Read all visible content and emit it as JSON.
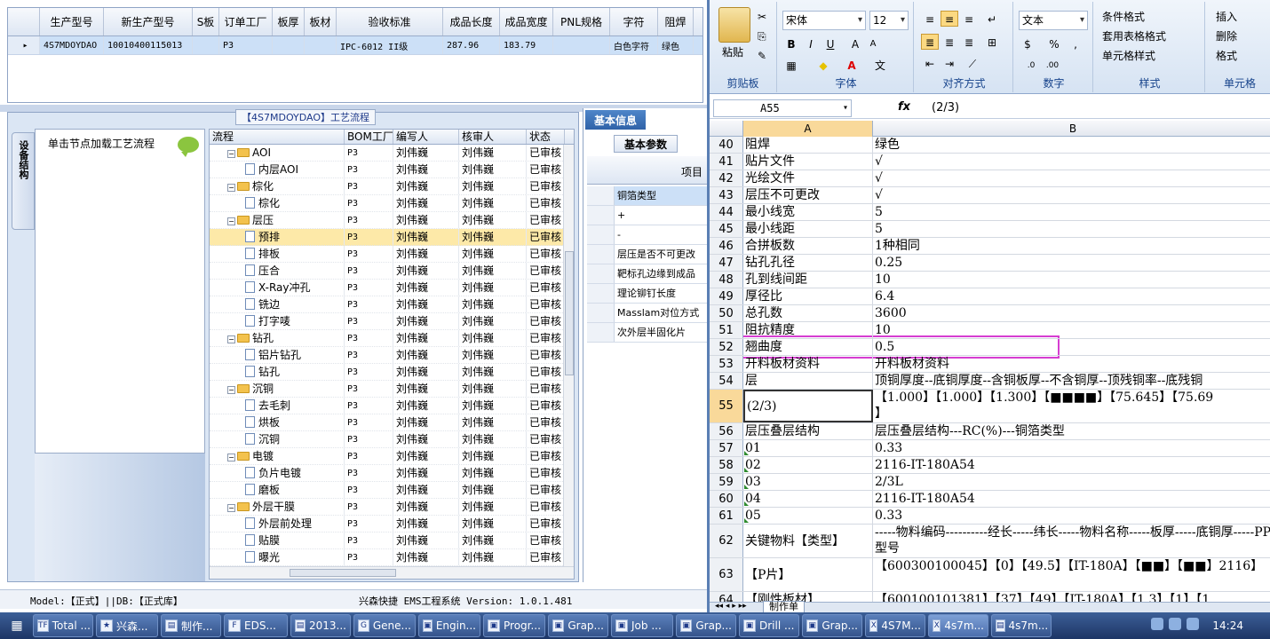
{
  "top_grid": {
    "columns": [
      "",
      "生产型号",
      "新生产型号",
      "S板",
      "订单工厂",
      "板厚",
      "板材",
      "验收标准",
      "成品长度",
      "成品宽度",
      "PNL规格",
      "字符",
      "阻焊"
    ],
    "row": [
      "▸",
      "4S7MDOYDAO",
      "10010400115013",
      "",
      "P3",
      "",
      "",
      "IPC-6012 II级",
      "287.96",
      "183.79",
      "",
      "白色字符",
      "绿色"
    ]
  },
  "process": {
    "title": "【4S7MDOYDAO】工艺流程",
    "side_tab": "设备结构",
    "hint": "单击节点加载工艺流程",
    "headers": [
      "流程",
      "BOM工厂",
      "编写人",
      "核审人",
      "状态"
    ],
    "rows": [
      {
        "level": 0,
        "type": "folder",
        "name": "AOI",
        "bom": "P3",
        "writer": "刘伟巍",
        "reviewer": "刘伟巍",
        "status": "已审核"
      },
      {
        "level": 1,
        "type": "doc",
        "name": "内层AOI",
        "bom": "P3",
        "writer": "刘伟巍",
        "reviewer": "刘伟巍",
        "status": "已审核"
      },
      {
        "level": 0,
        "type": "folder",
        "name": "棕化",
        "bom": "P3",
        "writer": "刘伟巍",
        "reviewer": "刘伟巍",
        "status": "已审核"
      },
      {
        "level": 1,
        "type": "doc",
        "name": "棕化",
        "bom": "P3",
        "writer": "刘伟巍",
        "reviewer": "刘伟巍",
        "status": "已审核"
      },
      {
        "level": 0,
        "type": "folder",
        "name": "层压",
        "bom": "P3",
        "writer": "刘伟巍",
        "reviewer": "刘伟巍",
        "status": "已审核"
      },
      {
        "level": 1,
        "type": "doc",
        "name": "预排",
        "bom": "P3",
        "writer": "刘伟巍",
        "reviewer": "刘伟巍",
        "status": "已审核",
        "highlight": true
      },
      {
        "level": 1,
        "type": "doc",
        "name": "排板",
        "bom": "P3",
        "writer": "刘伟巍",
        "reviewer": "刘伟巍",
        "status": "已审核"
      },
      {
        "level": 1,
        "type": "doc",
        "name": "压合",
        "bom": "P3",
        "writer": "刘伟巍",
        "reviewer": "刘伟巍",
        "status": "已审核"
      },
      {
        "level": 1,
        "type": "doc",
        "name": "X-Ray冲孔",
        "bom": "P3",
        "writer": "刘伟巍",
        "reviewer": "刘伟巍",
        "status": "已审核"
      },
      {
        "level": 1,
        "type": "doc",
        "name": "铣边",
        "bom": "P3",
        "writer": "刘伟巍",
        "reviewer": "刘伟巍",
        "status": "已审核"
      },
      {
        "level": 1,
        "type": "doc",
        "name": "打字唛",
        "bom": "P3",
        "writer": "刘伟巍",
        "reviewer": "刘伟巍",
        "status": "已审核"
      },
      {
        "level": 0,
        "type": "folder",
        "name": "钻孔",
        "bom": "P3",
        "writer": "刘伟巍",
        "reviewer": "刘伟巍",
        "status": "已审核"
      },
      {
        "level": 1,
        "type": "doc",
        "name": "铝片钻孔",
        "bom": "P3",
        "writer": "刘伟巍",
        "reviewer": "刘伟巍",
        "status": "已审核"
      },
      {
        "level": 1,
        "type": "doc",
        "name": "钻孔",
        "bom": "P3",
        "writer": "刘伟巍",
        "reviewer": "刘伟巍",
        "status": "已审核"
      },
      {
        "level": 0,
        "type": "folder",
        "name": "沉铜",
        "bom": "P3",
        "writer": "刘伟巍",
        "reviewer": "刘伟巍",
        "status": "已审核"
      },
      {
        "level": 1,
        "type": "doc",
        "name": "去毛刺",
        "bom": "P3",
        "writer": "刘伟巍",
        "reviewer": "刘伟巍",
        "status": "已审核"
      },
      {
        "level": 1,
        "type": "doc",
        "name": "烘板",
        "bom": "P3",
        "writer": "刘伟巍",
        "reviewer": "刘伟巍",
        "status": "已审核"
      },
      {
        "level": 1,
        "type": "doc",
        "name": "沉铜",
        "bom": "P3",
        "writer": "刘伟巍",
        "reviewer": "刘伟巍",
        "status": "已审核"
      },
      {
        "level": 0,
        "type": "folder",
        "name": "电镀",
        "bom": "P3",
        "writer": "刘伟巍",
        "reviewer": "刘伟巍",
        "status": "已审核"
      },
      {
        "level": 1,
        "type": "doc",
        "name": "负片电镀",
        "bom": "P3",
        "writer": "刘伟巍",
        "reviewer": "刘伟巍",
        "status": "已审核"
      },
      {
        "level": 1,
        "type": "doc",
        "name": "磨板",
        "bom": "P3",
        "writer": "刘伟巍",
        "reviewer": "刘伟巍",
        "status": "已审核"
      },
      {
        "level": 0,
        "type": "folder",
        "name": "外层干膜",
        "bom": "P3",
        "writer": "刘伟巍",
        "reviewer": "刘伟巍",
        "status": "已审核"
      },
      {
        "level": 1,
        "type": "doc",
        "name": "外层前处理",
        "bom": "P3",
        "writer": "刘伟巍",
        "reviewer": "刘伟巍",
        "status": "已审核"
      },
      {
        "level": 1,
        "type": "doc",
        "name": "贴膜",
        "bom": "P3",
        "writer": "刘伟巍",
        "reviewer": "刘伟巍",
        "status": "已审核"
      },
      {
        "level": 1,
        "type": "doc",
        "name": "曝光",
        "bom": "P3",
        "writer": "刘伟巍",
        "reviewer": "刘伟巍",
        "status": "已审核"
      }
    ]
  },
  "info": {
    "tab": "基本信息",
    "subtab": "基本参数",
    "header": "项目",
    "rows": [
      "铜箔类型",
      "+",
      "-",
      "层压是否不可更改",
      "靶标孔边缘到成品",
      "理论铆钉长度",
      "Masslam对位方式",
      "次外层半固化片"
    ]
  },
  "status_bar": {
    "left": "Model:【正式】||DB:【正式库】",
    "center": "兴森快捷 EMS工程系统 Version: 1.0.1.481"
  },
  "excel": {
    "font": "宋体",
    "size": "12",
    "numfmt": "文本",
    "groups": [
      "剪贴板",
      "字体",
      "对齐方式",
      "数字",
      "样式",
      "单元格"
    ],
    "paste": "粘贴",
    "styles": [
      "条件格式",
      "套用表格格式",
      "单元格样式"
    ],
    "cells": [
      "插入",
      "删除",
      "格式"
    ],
    "namebox": "A55",
    "formula": "(2/3)",
    "col_a": "A",
    "col_b": "B",
    "rows": [
      {
        "n": "40",
        "a": "阻焊",
        "b": "绿色"
      },
      {
        "n": "41",
        "a": "贴片文件",
        "b": "√"
      },
      {
        "n": "42",
        "a": "光绘文件",
        "b": "√"
      },
      {
        "n": "43",
        "a": "层压不可更改",
        "b": "√"
      },
      {
        "n": "44",
        "a": "最小线宽",
        "b": "5"
      },
      {
        "n": "45",
        "a": "最小线距",
        "b": "5"
      },
      {
        "n": "46",
        "a": "合拼板数",
        "b": "1种相同"
      },
      {
        "n": "47",
        "a": "钻孔孔径",
        "b": "0.25"
      },
      {
        "n": "48",
        "a": "孔到线间距",
        "b": "10"
      },
      {
        "n": "49",
        "a": "厚径比",
        "b": "6.4"
      },
      {
        "n": "50",
        "a": "总孔数",
        "b": "3600"
      },
      {
        "n": "51",
        "a": "阻抗精度",
        "b": "10"
      },
      {
        "n": "52",
        "a": "翘曲度",
        "b": "0.5"
      },
      {
        "n": "53",
        "a": "开料板材资料",
        "b": "开料板材资料"
      },
      {
        "n": "54",
        "a": "层",
        "b": "顶铜厚度--底铜厚度--含铜板厚--不含铜厚--顶残铜率--底残铜"
      },
      {
        "n": "55",
        "a": "(2/3)",
        "b": "【1.000】【1.000】【1.300】【■■■■】【75.645】【75.69\n】",
        "tall": true,
        "sel": true
      },
      {
        "n": "56",
        "a": "层压叠层结构",
        "b": "层压叠层结构---RC(%)---铜箔类型"
      },
      {
        "n": "57",
        "a": "01",
        "b": "0.33"
      },
      {
        "n": "58",
        "a": "02",
        "b": "2116-IT-180A54"
      },
      {
        "n": "59",
        "a": "03",
        "b": "2/3L"
      },
      {
        "n": "60",
        "a": "04",
        "b": "2116-IT-180A54"
      },
      {
        "n": "61",
        "a": "05",
        "b": "0.33"
      },
      {
        "n": "62",
        "a": "关键物料【类型】",
        "b": "-----物料编码----------经长-----纬长-----物料名称-----板厚-----底铜厚-----PP型号",
        "tall": true
      },
      {
        "n": "63",
        "a": "【P片】",
        "b": "【600300100045】【0】【49.5】【IT-180A】【■■】【■■】2116】",
        "tall": true
      },
      {
        "n": "64",
        "a": "【刚性板材】",
        "b": "【600100101381】【37】【49】【IT-180A】【1.3】【1】【1"
      }
    ],
    "sheet_tab": "制作单"
  },
  "taskbar": {
    "items": [
      {
        "icon": "TF",
        "label": "Total ..."
      },
      {
        "icon": "★",
        "label": "兴森..."
      },
      {
        "icon": "▤",
        "label": "制作..."
      },
      {
        "icon": "F",
        "label": "EDS..."
      },
      {
        "icon": "▤",
        "label": "2013..."
      },
      {
        "icon": "G",
        "label": "Gene..."
      },
      {
        "icon": "▣",
        "label": "Engin..."
      },
      {
        "icon": "▣",
        "label": "Progr..."
      },
      {
        "icon": "▣",
        "label": "Grap..."
      },
      {
        "icon": "▣",
        "label": "Job ..."
      },
      {
        "icon": "▣",
        "label": "Grap..."
      },
      {
        "icon": "▣",
        "label": "Drill ..."
      },
      {
        "icon": "▣",
        "label": "Grap..."
      },
      {
        "icon": "X",
        "label": "4S7M..."
      },
      {
        "icon": "X",
        "label": "4s7m..."
      },
      {
        "icon": "▤",
        "label": "4s7m..."
      }
    ],
    "clock": "14:24"
  }
}
